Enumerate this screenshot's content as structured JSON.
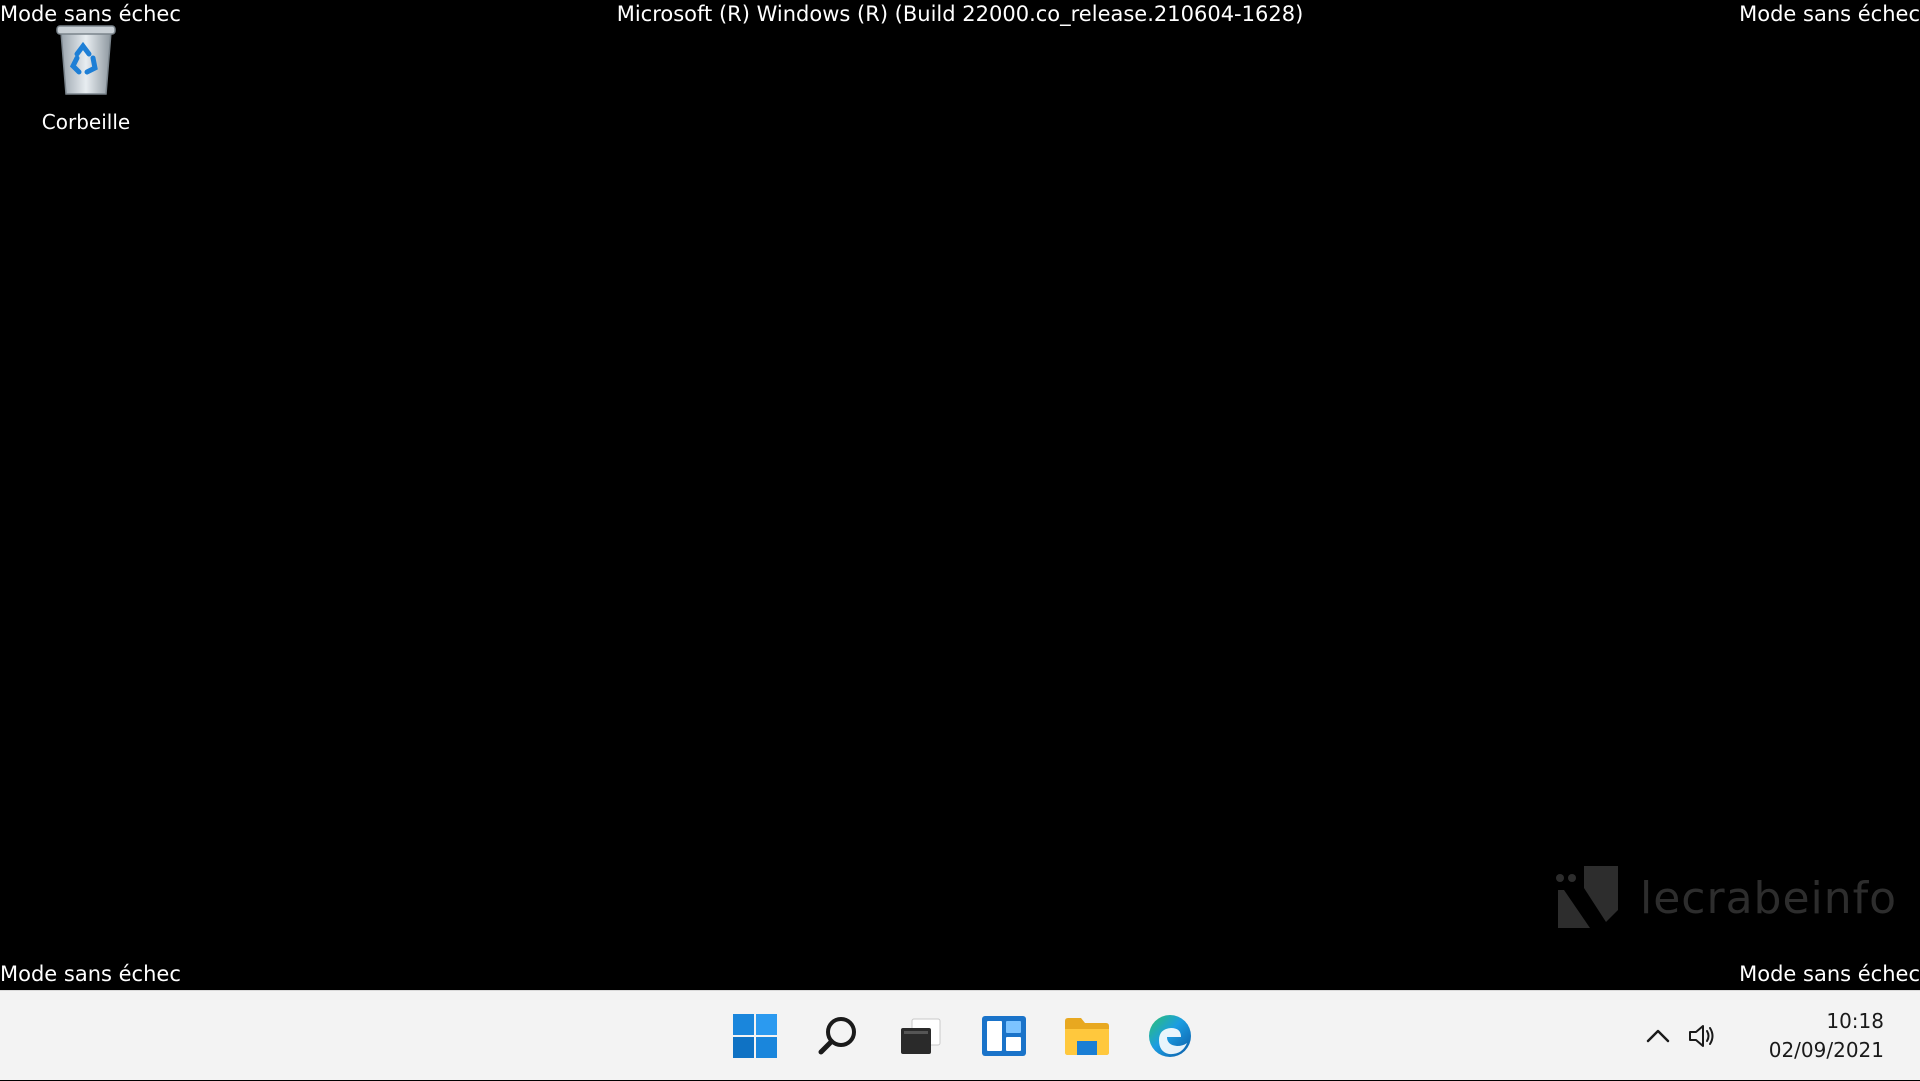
{
  "desktop": {
    "safe_mode_top_left": "Mode sans échec",
    "safe_mode_top_right": "Mode sans échec",
    "safe_mode_bottom_left": "Mode sans échec",
    "safe_mode_bottom_right": "Mode sans échec",
    "build_string": "Microsoft (R) Windows (R) (Build 22000.co_release.210604-1628)",
    "background_color": "#000000",
    "icons": [
      {
        "label": "Corbeille",
        "icon": "recycle-bin-icon"
      }
    ],
    "watermark": {
      "text": "lecrabeinfo",
      "icon": "lecrabeinfo-logo-icon"
    }
  },
  "taskbar": {
    "background_color": "#f3f3f3",
    "apps": [
      {
        "name": "Start",
        "icon": "windows-start-icon"
      },
      {
        "name": "Search",
        "icon": "search-icon"
      },
      {
        "name": "Task View",
        "icon": "task-view-icon"
      },
      {
        "name": "Widgets",
        "icon": "widgets-icon"
      },
      {
        "name": "File Explorer",
        "icon": "folder-icon"
      },
      {
        "name": "Microsoft Edge",
        "icon": "edge-icon"
      }
    ],
    "tray": {
      "overflow_icon": "chevron-up-icon",
      "volume_icon": "speaker-icon",
      "time": "10:18",
      "date": "02/09/2021"
    }
  }
}
